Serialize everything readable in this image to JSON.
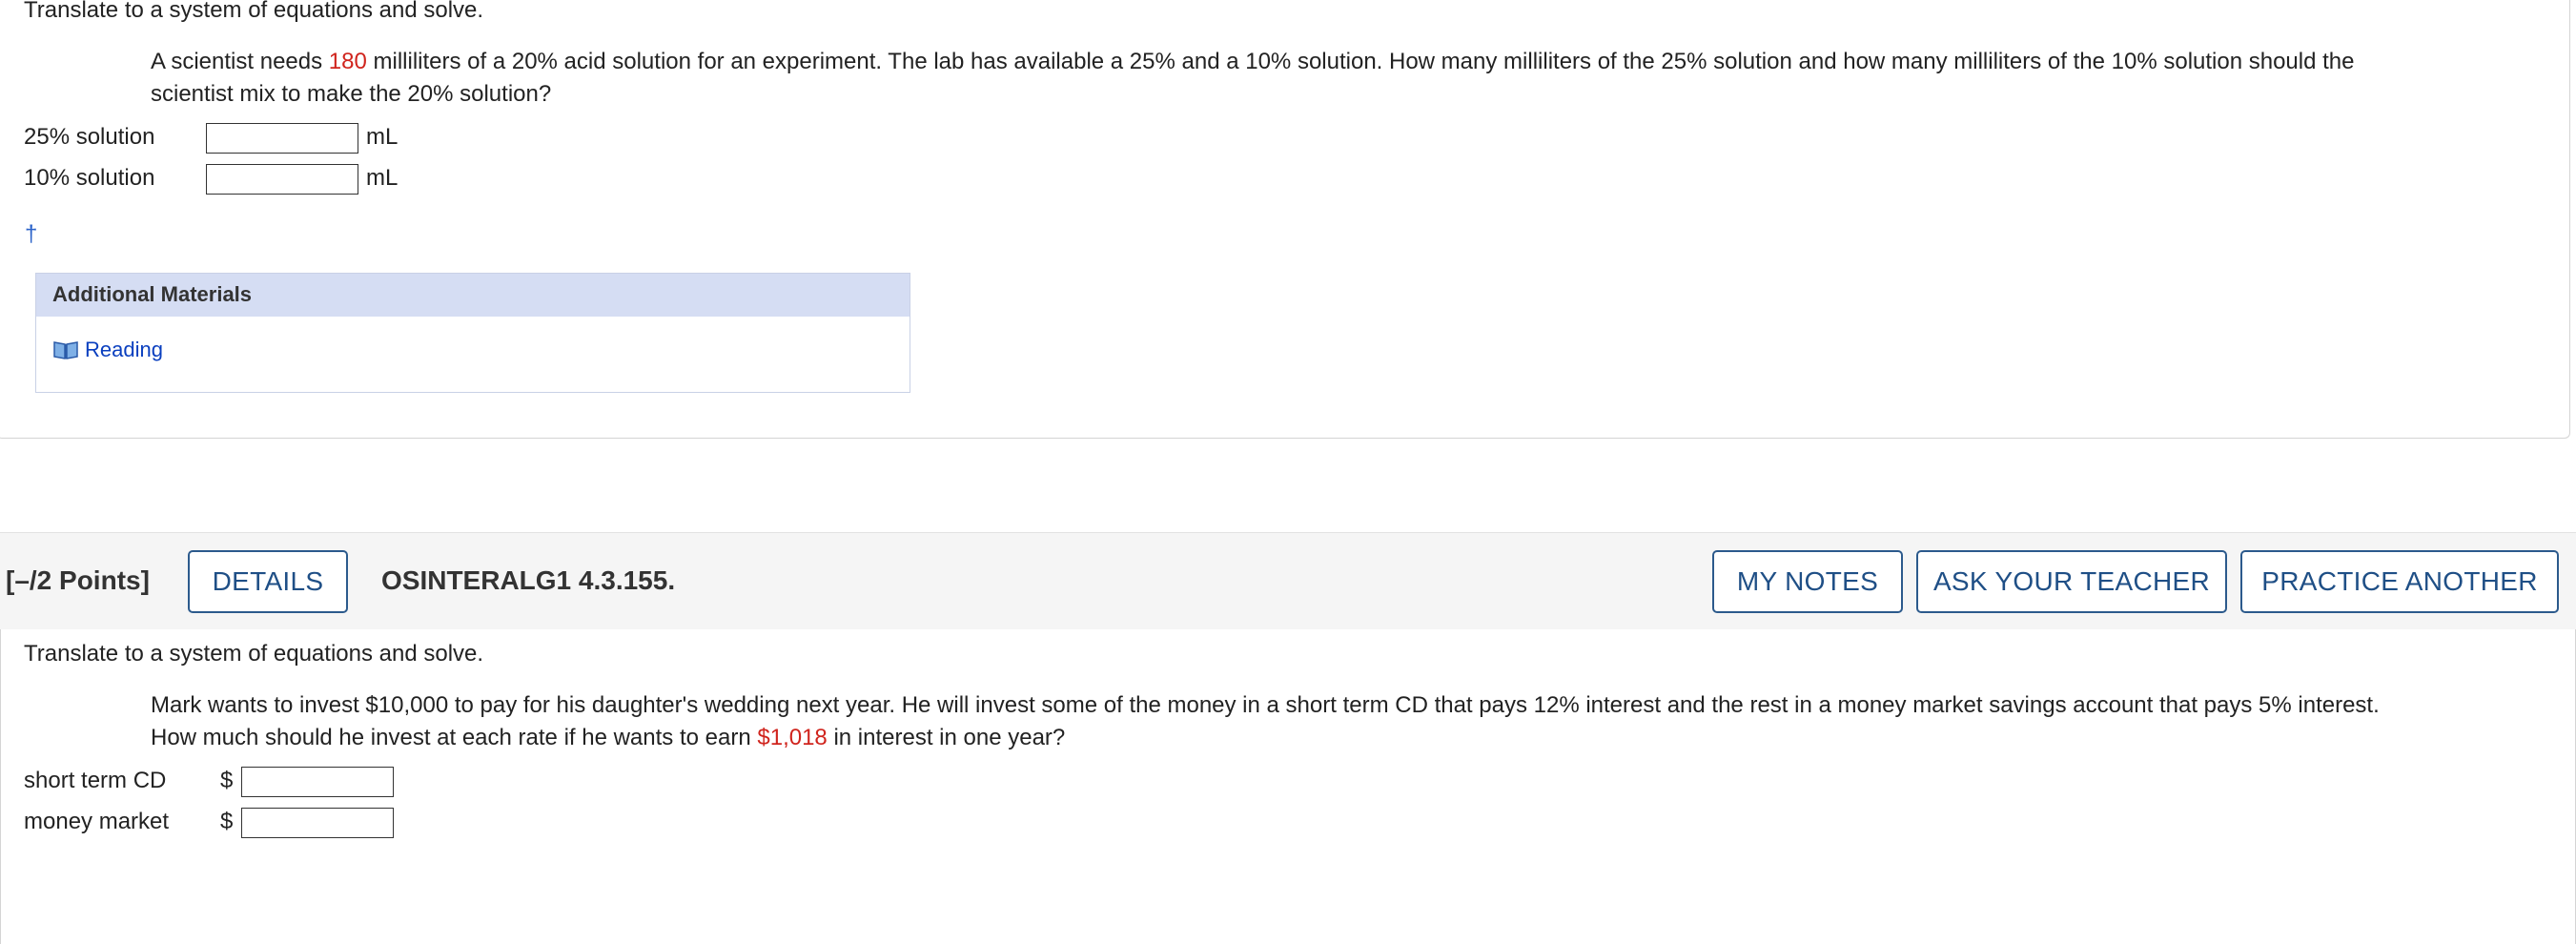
{
  "q1": {
    "instruction": "Translate to a system of equations and solve.",
    "problem_before": "A scientist needs ",
    "problem_highlight": "180",
    "problem_line1_rest": " milliliters of a 20% acid solution for an experiment. The lab has available a 25% and a 10% solution. How many milliliters of the 25% solution and how many milliliters of the 10% solution should the",
    "problem_line2": "scientist mix to make the 20% solution?",
    "fields": [
      {
        "label": "25% solution",
        "unit": "mL",
        "value": ""
      },
      {
        "label": "10% solution",
        "unit": "mL",
        "value": ""
      }
    ],
    "dagger": "†",
    "additional_materials": {
      "title": "Additional Materials",
      "link": "Reading",
      "icon": "book-icon"
    }
  },
  "q2": {
    "points": "[–/2 Points]",
    "details_label": "DETAILS",
    "code": "OSINTERALG1 4.3.155.",
    "my_notes_label": "MY NOTES",
    "ask_teacher_label": "ASK YOUR TEACHER",
    "practice_label": "PRACTICE ANOTHER",
    "instruction": "Translate to a system of equations and solve.",
    "problem_line1": "Mark wants to invest $10,000 to pay for his daughter's wedding next year. He will invest some of the money in a short term CD that pays 12% interest and the rest in a money market savings account that pays 5% interest.",
    "problem_line2_before": "How much should he invest at each rate if he wants to earn ",
    "problem_line2_dollar": "$",
    "problem_highlight": "1,018",
    "problem_line2_after": " in interest in one year?",
    "fields": [
      {
        "label": "short term CD",
        "prefix": "$",
        "value": ""
      },
      {
        "label": "money market",
        "prefix": "$",
        "value": ""
      }
    ]
  },
  "colors": {
    "highlight": "#d0241d",
    "button_border": "#2c5a8c",
    "link": "#0a3fbf",
    "panel_header": "#d5ddf3"
  }
}
